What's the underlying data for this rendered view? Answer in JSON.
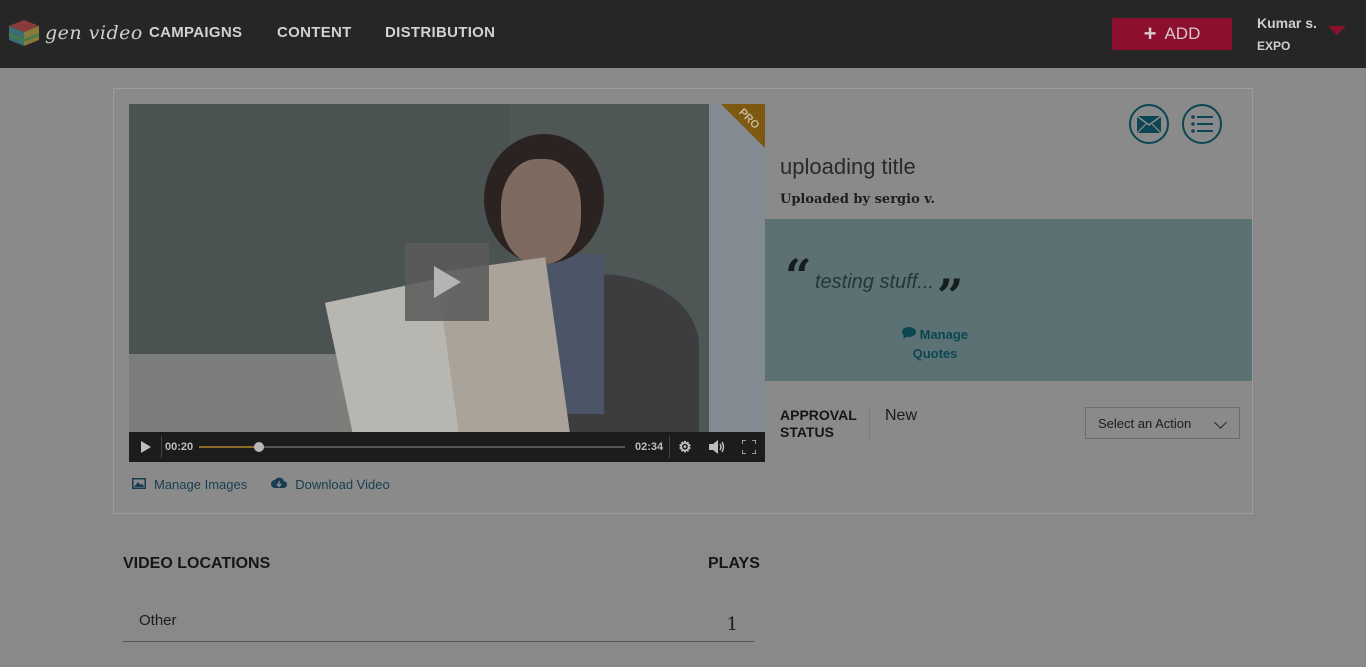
{
  "header": {
    "logo_text": "gen video",
    "nav": [
      "CAMPAIGNS",
      "CONTENT",
      "DISTRIBUTION"
    ],
    "add_label": "ADD",
    "user_name": "Kumar s.",
    "user_org": "EXPO"
  },
  "video": {
    "badge": "PRO",
    "current_time": "00:20",
    "total_time": "02:34",
    "progress": 0.14
  },
  "video_links": {
    "manage_images": "Manage Images",
    "download_video": "Download Video"
  },
  "details": {
    "title": "uploading title",
    "uploaded_by": "Uploaded by sergio v.",
    "quote_open": "“",
    "quote_text": "testing stuff...",
    "quote_close": "”",
    "manage_quotes": "Manage Quotes",
    "approval_label": "APPROVAL STATUS",
    "approval_value": "New",
    "action_placeholder": "Select an Action"
  },
  "locations": {
    "header": "VIDEO LOCATIONS",
    "plays_header": "PLAYS",
    "rows": [
      {
        "name": "Other",
        "plays": "1"
      }
    ]
  },
  "colors": {
    "topbar": "#262626",
    "accent_add": "#8c0f2e",
    "teal": "#0c4654",
    "quote_bg": "#5c7174"
  }
}
